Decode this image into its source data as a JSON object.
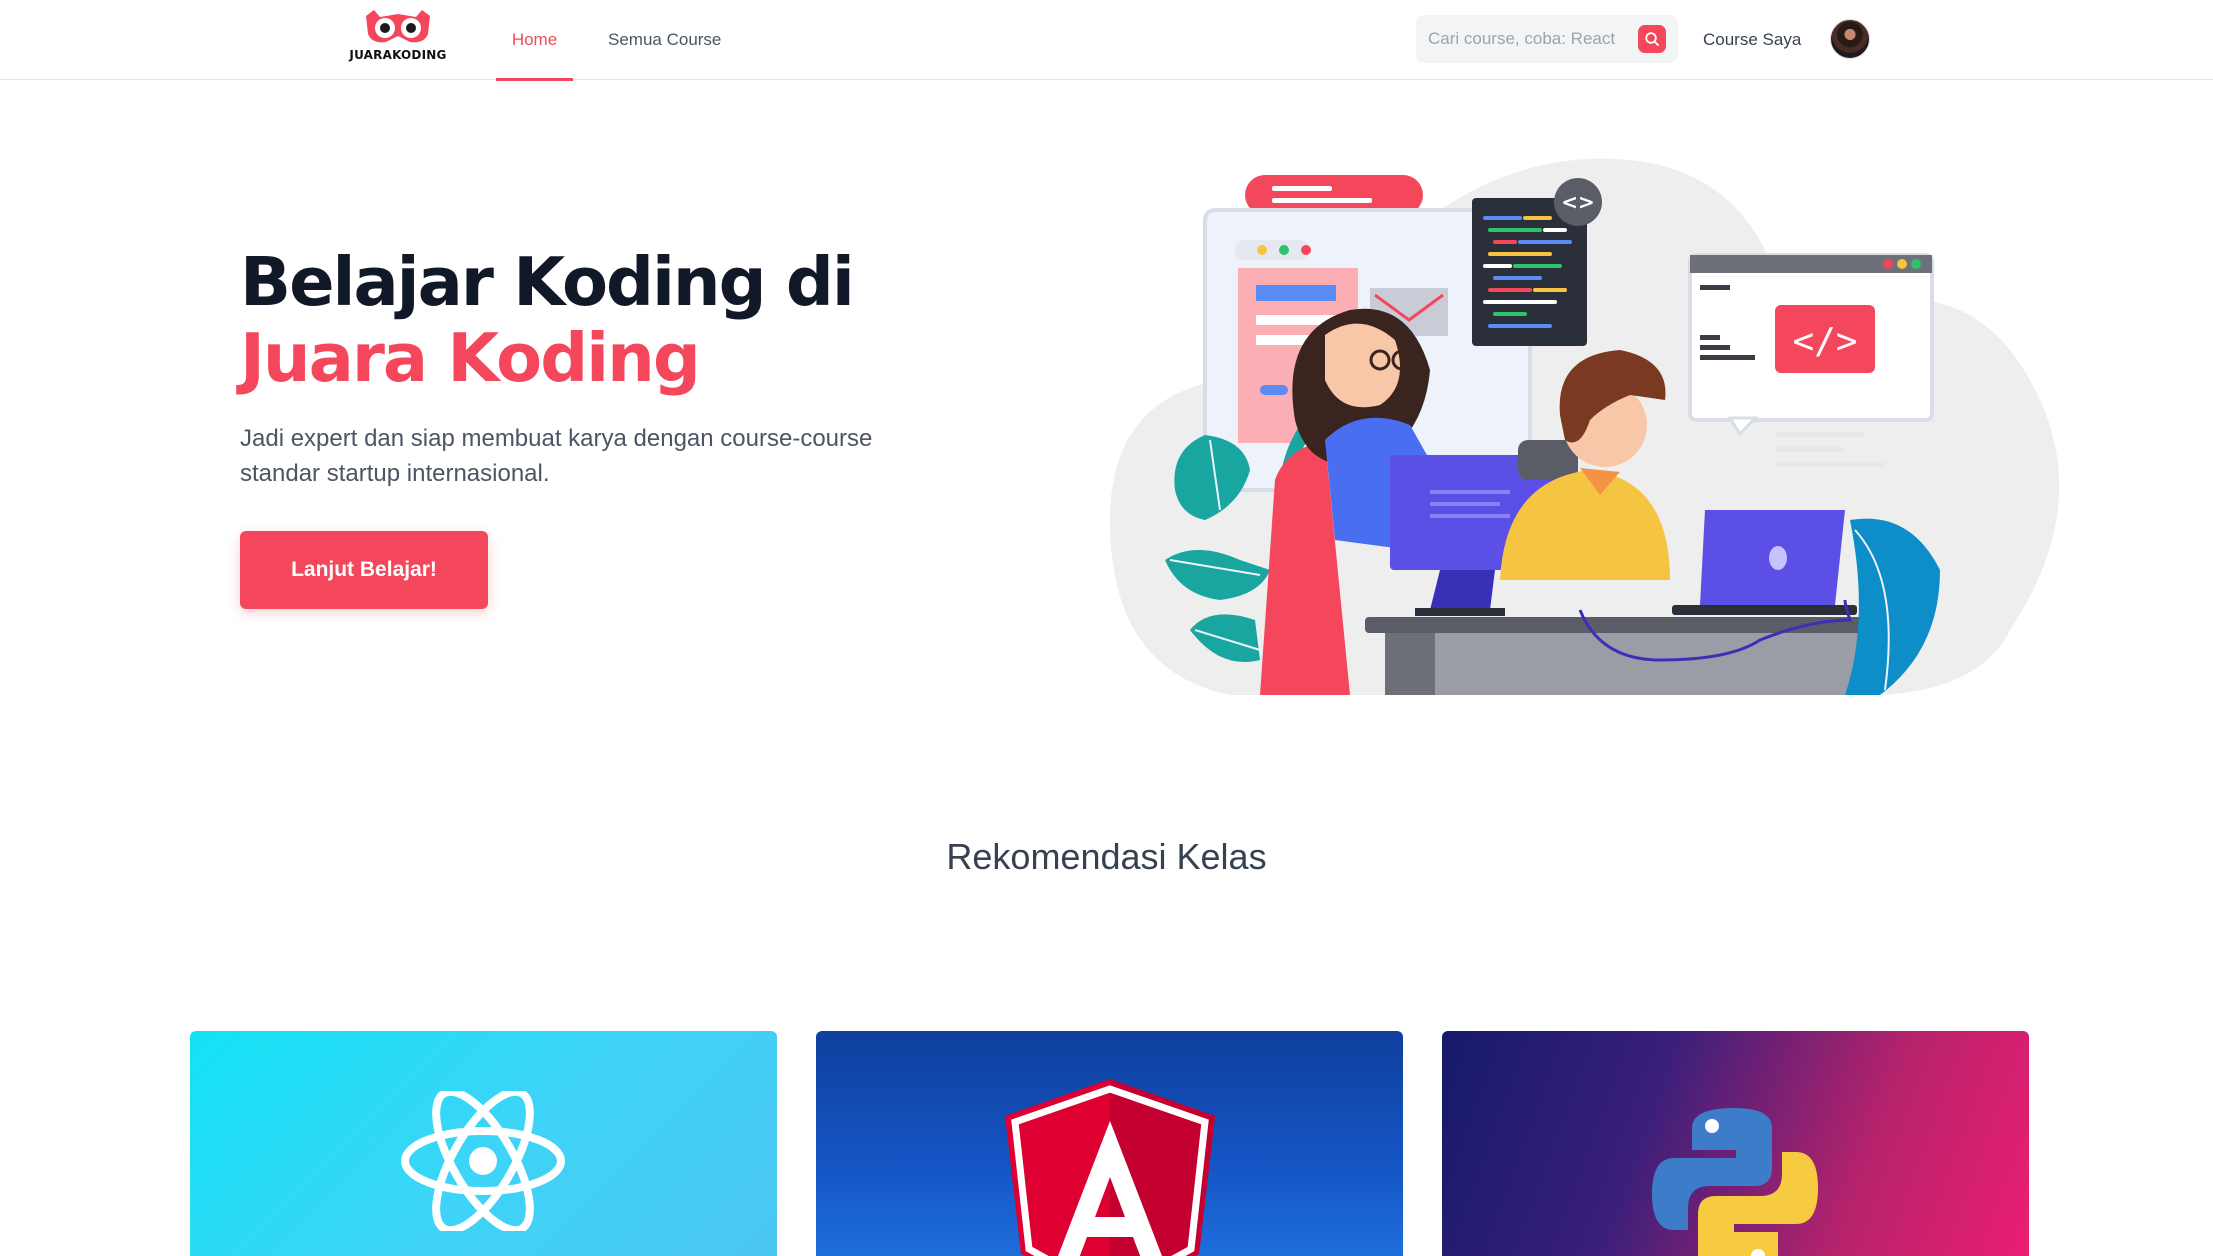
{
  "brand": {
    "name": "JUARAKODING",
    "accent_color": "#f5475b"
  },
  "nav": {
    "home_label": "Home",
    "all_courses_label": "Semua Course",
    "my_courses_label": "Course Saya"
  },
  "search": {
    "placeholder": "Cari course, coba: React"
  },
  "hero": {
    "title_line1": "Belajar Koding di",
    "title_line2": "Juara Koding",
    "subtitle": "Jadi expert dan siap membuat karya dengan course-course standar startup internasional.",
    "cta_label": "Lanjut Belajar!"
  },
  "recommendations": {
    "title": "Rekomendasi Kelas",
    "cards": [
      {
        "icon": "react-logo-icon",
        "color": "#2fd8f6"
      },
      {
        "icon": "angular-logo-icon",
        "color": "#1452c0"
      },
      {
        "icon": "python-logo-icon",
        "color": "#e41e72"
      }
    ]
  }
}
